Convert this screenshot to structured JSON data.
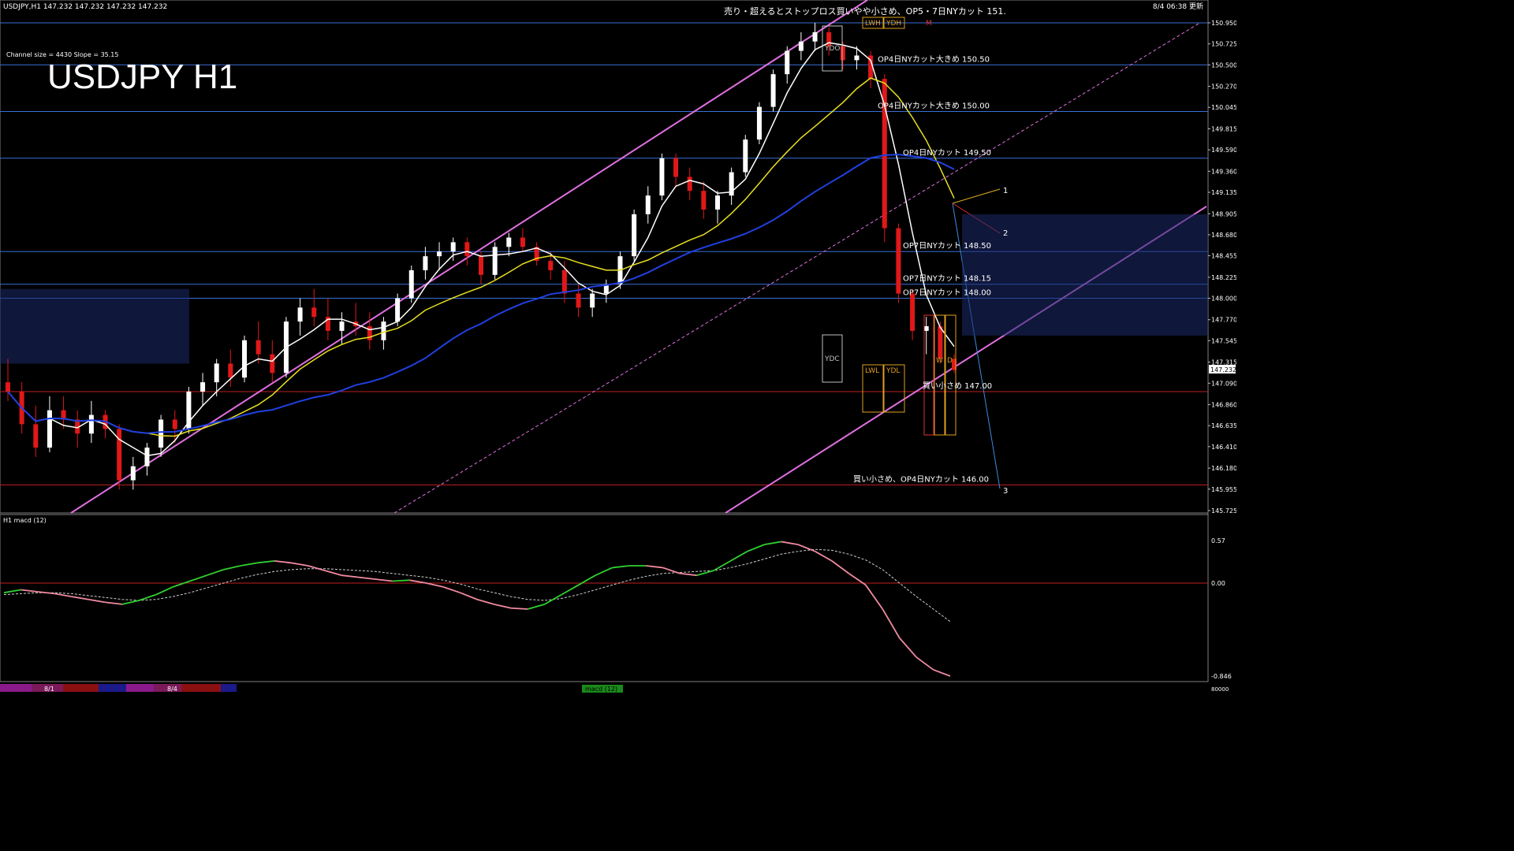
{
  "header": {
    "symbol_line": "USDJPY,H1  147.232 147.232 147.232 147.232",
    "datetime": "8/4 06:38 更新",
    "notice": "売り・超えるとストップロス買いやや小さめ、OP5・7日NYカット 151.",
    "channel_info": "Channel size = 4430 Slope = 35.15",
    "big_title": "USDJPY H1"
  },
  "price_axis": {
    "labels": [
      "150.950",
      "150.725",
      "150.500",
      "150.270",
      "150.045",
      "149.815",
      "149.590",
      "149.360",
      "149.135",
      "148.905",
      "148.680",
      "148.455",
      "148.225",
      "148.000",
      "147.770",
      "147.545",
      "147.315",
      "147.090",
      "146.860",
      "146.635",
      "146.410",
      "146.180",
      "145.955",
      "145.725"
    ],
    "min": 145.725,
    "max": 150.95,
    "current": "147.232"
  },
  "horizontal_levels": [
    {
      "price": 150.95,
      "color": "#3a6fd8"
    },
    {
      "price": 150.5,
      "color": "#3a6fd8"
    },
    {
      "price": 150.0,
      "color": "#3a6fd8"
    },
    {
      "price": 149.5,
      "color": "#3a6fd8"
    },
    {
      "price": 148.5,
      "color": "#3a6fd8"
    },
    {
      "price": 148.15,
      "color": "#3a6fd8"
    },
    {
      "price": 148.0,
      "color": "#3a6fd8"
    },
    {
      "price": 147.0,
      "color": "#c02020"
    },
    {
      "price": 146.0,
      "color": "#c02020"
    }
  ],
  "option_labels": [
    {
      "text": "OP4日NYカット大きめ 150.50",
      "price": 150.5
    },
    {
      "text": "OP4日NYカット大きめ 150.00",
      "price": 150.0
    },
    {
      "text": "OP4日NYカット 149.50",
      "price": 149.5
    },
    {
      "text": "OP7日NYカット 148.50",
      "price": 148.5
    },
    {
      "text": "OP7日NYカット 148.15",
      "price": 148.15
    },
    {
      "text": "OP7日NYカット 148.00",
      "price": 148.0
    },
    {
      "text": "買い小さめ 147.00",
      "price": 147.0
    },
    {
      "text": "買い小さめ、OP4日NYカット 146.00",
      "price": 146.0
    }
  ],
  "box_labels": {
    "ydo": "YDO",
    "ydc": "YDC",
    "lwh": "LWH",
    "ydh": "YDH",
    "lwl": "LWL",
    "ydl": "YDL",
    "m": "M",
    "w": "W",
    "d": "D"
  },
  "fan_labels": [
    "1",
    "2",
    "3"
  ],
  "macd": {
    "label": "H1  macd (12)",
    "axis": [
      "0.57",
      "0.00",
      "-0.846"
    ],
    "min": -0.846,
    "max": 0.57
  },
  "time_axis": {
    "labels": [
      "8/1",
      "8/4"
    ],
    "scroll_label": "macd (12)",
    "right_value": "80000"
  },
  "colors": {
    "bull": "#ffffff",
    "bear": "#e01818",
    "axis": "#c0c0c0",
    "level_blue": "#3a6fd8",
    "level_red": "#c02020",
    "channel": "#e070e0",
    "label": "#ffffff"
  },
  "chart_data": {
    "type": "candlestick",
    "title": "USDJPY H1",
    "ylim": [
      145.725,
      150.95
    ],
    "ohlc": [
      [
        147.1,
        147.35,
        146.9,
        147.0
      ],
      [
        147.0,
        147.1,
        146.55,
        146.65
      ],
      [
        146.65,
        146.85,
        146.3,
        146.4
      ],
      [
        146.4,
        146.95,
        146.35,
        146.8
      ],
      [
        146.8,
        146.95,
        146.6,
        146.7
      ],
      [
        146.7,
        146.8,
        146.4,
        146.55
      ],
      [
        146.55,
        146.9,
        146.45,
        146.75
      ],
      [
        146.75,
        146.8,
        146.5,
        146.6
      ],
      [
        146.6,
        146.65,
        145.95,
        146.05
      ],
      [
        146.05,
        146.3,
        145.95,
        146.2
      ],
      [
        146.2,
        146.45,
        146.1,
        146.4
      ],
      [
        146.4,
        146.75,
        146.3,
        146.7
      ],
      [
        146.7,
        146.8,
        146.45,
        146.6
      ],
      [
        146.6,
        147.05,
        146.55,
        147.0
      ],
      [
        147.0,
        147.2,
        146.85,
        147.1
      ],
      [
        147.1,
        147.35,
        146.95,
        147.3
      ],
      [
        147.3,
        147.45,
        147.05,
        147.15
      ],
      [
        147.15,
        147.6,
        147.1,
        147.55
      ],
      [
        147.55,
        147.75,
        147.3,
        147.4
      ],
      [
        147.4,
        147.55,
        147.1,
        147.2
      ],
      [
        147.2,
        147.8,
        147.15,
        147.75
      ],
      [
        147.75,
        148.0,
        147.6,
        147.9
      ],
      [
        147.9,
        148.1,
        147.7,
        147.8
      ],
      [
        147.8,
        148.0,
        147.55,
        147.65
      ],
      [
        147.65,
        147.85,
        147.5,
        147.75
      ],
      [
        147.75,
        147.95,
        147.6,
        147.7
      ],
      [
        147.7,
        147.85,
        147.45,
        147.55
      ],
      [
        147.55,
        147.8,
        147.45,
        147.75
      ],
      [
        147.75,
        148.05,
        147.7,
        148.0
      ],
      [
        148.0,
        148.35,
        147.95,
        148.3
      ],
      [
        148.3,
        148.55,
        148.2,
        148.45
      ],
      [
        148.45,
        148.6,
        148.3,
        148.5
      ],
      [
        148.5,
        148.65,
        148.4,
        148.6
      ],
      [
        148.6,
        148.65,
        148.35,
        148.45
      ],
      [
        148.45,
        148.5,
        148.15,
        148.25
      ],
      [
        148.25,
        148.6,
        148.2,
        148.55
      ],
      [
        148.55,
        148.7,
        148.45,
        148.65
      ],
      [
        148.65,
        148.75,
        148.5,
        148.55
      ],
      [
        148.55,
        148.6,
        148.35,
        148.4
      ],
      [
        148.4,
        148.5,
        148.2,
        148.3
      ],
      [
        148.3,
        148.4,
        147.95,
        148.05
      ],
      [
        148.05,
        148.15,
        147.8,
        147.9
      ],
      [
        147.9,
        148.1,
        147.8,
        148.05
      ],
      [
        148.05,
        148.2,
        147.95,
        148.15
      ],
      [
        148.15,
        148.5,
        148.1,
        148.45
      ],
      [
        148.45,
        148.95,
        148.4,
        148.9
      ],
      [
        148.9,
        149.2,
        148.8,
        149.1
      ],
      [
        149.1,
        149.55,
        149.05,
        149.5
      ],
      [
        149.5,
        149.55,
        149.2,
        149.3
      ],
      [
        149.3,
        149.4,
        149.05,
        149.15
      ],
      [
        149.15,
        149.25,
        148.85,
        148.95
      ],
      [
        148.95,
        149.15,
        148.8,
        149.1
      ],
      [
        149.1,
        149.4,
        149.0,
        149.35
      ],
      [
        149.35,
        149.75,
        149.3,
        149.7
      ],
      [
        149.7,
        150.1,
        149.65,
        150.05
      ],
      [
        150.05,
        150.45,
        150.0,
        150.4
      ],
      [
        150.4,
        150.7,
        150.3,
        150.65
      ],
      [
        150.65,
        150.85,
        150.55,
        150.75
      ],
      [
        150.75,
        150.95,
        150.65,
        150.85
      ],
      [
        150.85,
        150.9,
        150.6,
        150.7
      ],
      [
        150.7,
        150.75,
        150.45,
        150.55
      ],
      [
        150.55,
        150.7,
        150.45,
        150.6
      ],
      [
        150.6,
        150.65,
        150.25,
        150.35
      ],
      [
        150.35,
        150.4,
        148.6,
        148.75
      ],
      [
        148.75,
        148.8,
        147.95,
        148.05
      ],
      [
        148.05,
        148.1,
        147.55,
        147.65
      ],
      [
        147.65,
        147.8,
        147.4,
        147.7
      ],
      [
        147.7,
        147.75,
        147.3,
        147.35
      ],
      [
        147.35,
        147.4,
        147.2,
        147.232
      ]
    ],
    "macd": [
      0.02,
      0.05,
      0.03,
      0.01,
      -0.02,
      -0.05,
      -0.08,
      -0.1,
      -0.06,
      0.0,
      0.08,
      0.14,
      0.2,
      0.26,
      0.3,
      0.33,
      0.35,
      0.33,
      0.3,
      0.25,
      0.2,
      0.18,
      0.16,
      0.14,
      0.15,
      0.12,
      0.08,
      0.02,
      -0.05,
      -0.1,
      -0.14,
      -0.15,
      -0.1,
      0.0,
      0.1,
      0.2,
      0.28,
      0.3,
      0.3,
      0.28,
      0.22,
      0.2,
      0.25,
      0.35,
      0.45,
      0.52,
      0.55,
      0.52,
      0.45,
      0.35,
      0.22,
      0.1,
      -0.15,
      -0.45,
      -0.65,
      -0.78,
      -0.846
    ],
    "macd_signal": [
      0.0,
      0.01,
      0.02,
      0.02,
      0.01,
      -0.01,
      -0.03,
      -0.05,
      -0.06,
      -0.05,
      -0.02,
      0.02,
      0.07,
      0.12,
      0.17,
      0.21,
      0.24,
      0.26,
      0.27,
      0.27,
      0.26,
      0.25,
      0.24,
      0.22,
      0.2,
      0.18,
      0.15,
      0.11,
      0.06,
      0.02,
      -0.02,
      -0.05,
      -0.06,
      -0.04,
      0.0,
      0.05,
      0.1,
      0.15,
      0.19,
      0.22,
      0.23,
      0.24,
      0.25,
      0.28,
      0.32,
      0.37,
      0.42,
      0.45,
      0.47,
      0.46,
      0.42,
      0.36,
      0.26,
      0.12,
      -0.02,
      -0.15,
      -0.28
    ]
  }
}
